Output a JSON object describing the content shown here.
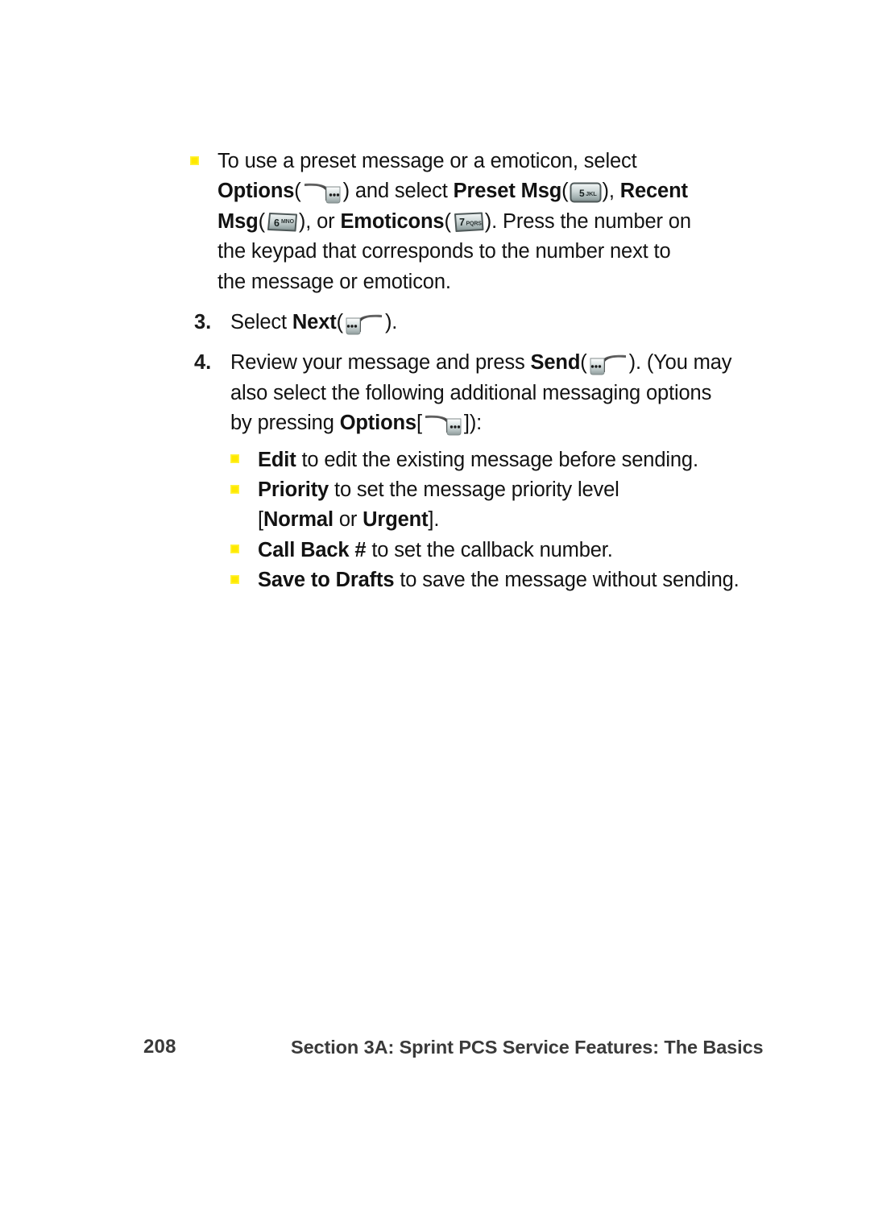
{
  "document": {
    "page_number": "208",
    "footer_title": "Section 3A: Sprint PCS Service Features: The Basics",
    "bullet_color": "#ffe800",
    "text_color": "#121212"
  },
  "content": {
    "preset_bullet": {
      "line1": "To use a preset message or a emoticon, select",
      "line2_a": "Options",
      "line2_open": "(",
      "line2_b": ") and select ",
      "line2_c": "Preset Msg",
      "line2_open2": "(",
      "line2_d": "), ",
      "line2_e": "Recent",
      "line3_a": "Msg",
      "line3_open": "(",
      "line3_b": "), or ",
      "line3_c": "Emoticons",
      "line3_open2": "(",
      "line3_d": "). Press the number on",
      "line4": "the keypad that corresponds to the number next to",
      "line5": "the message or emoticon."
    },
    "steps": [
      {
        "number": "3.",
        "line1_a": "Select ",
        "line1_b": "Next",
        "line1_open": "(",
        "line1_c": ")."
      },
      {
        "number": "4.",
        "line1_a": "Review your message and press ",
        "line1_b": "Send",
        "line1_open": "(",
        "line1_c": "). (You may",
        "line2": "also select the following additional messaging options",
        "line3_a": "by pressing ",
        "line3_b": "Options",
        "line3_open": "[",
        "line3_c": "]):"
      }
    ],
    "options": [
      {
        "bold": "Edit",
        "rest": " to edit the existing message before sending."
      },
      {
        "bold": "Priority",
        "rest": " to set the message priority level",
        "line2_open": "[",
        "line2_bold1": "Normal",
        "line2_mid": " or ",
        "line2_bold2": "Urgent",
        "line2_close": "]."
      },
      {
        "bold": "Call Back #",
        "rest": " to set the callback number."
      },
      {
        "bold": "Save to Drafts",
        "rest": " to save the message without sending."
      }
    ]
  },
  "keys": {
    "softkey_right_options": "right-softkey-options",
    "softkey_left_next": "left-softkey-next",
    "softkey_left_send": "left-softkey-send",
    "key5": {
      "digit": "5",
      "letters": "JKL"
    },
    "key6": {
      "digit": "6",
      "letters": "MNO"
    },
    "key7": {
      "digit": "7",
      "letters": "PQRS"
    }
  }
}
